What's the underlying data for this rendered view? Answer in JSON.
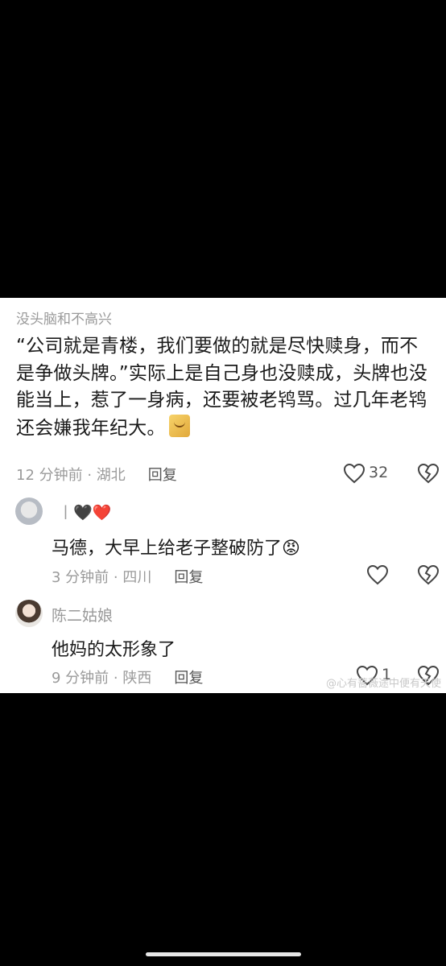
{
  "main_comment": {
    "author": "没头脑和不高兴",
    "text": "“公司就是青楼，我们要做的就是尽快赎身，而不是争做头牌。”实际上是自己身也没赎成，头牌也没能当上，惹了一身病，还要被老鸨骂。过几年老鸨还会嫌我年纪大。",
    "time_location": "12 分钟前 · 湖北",
    "reply_label": "回复",
    "like_count": "32"
  },
  "replies": [
    {
      "author": "丨🖤❤️",
      "text": "马德，大早上给老子整破防了😡",
      "time_location": "3 分钟前 · 四川",
      "reply_label": "回复"
    },
    {
      "author": "陈二姑娘",
      "text": "他妈的太形象了",
      "time_location": "9 分钟前 · 陕西",
      "reply_label": "回复",
      "like_count": "1"
    }
  ],
  "watermark": "@心有蔷薇途中便有天使",
  "colors": {
    "background": "#000000",
    "panel": "#ffffff",
    "meta_gray": "#9a9a9a",
    "text": "#1a1a1a"
  }
}
